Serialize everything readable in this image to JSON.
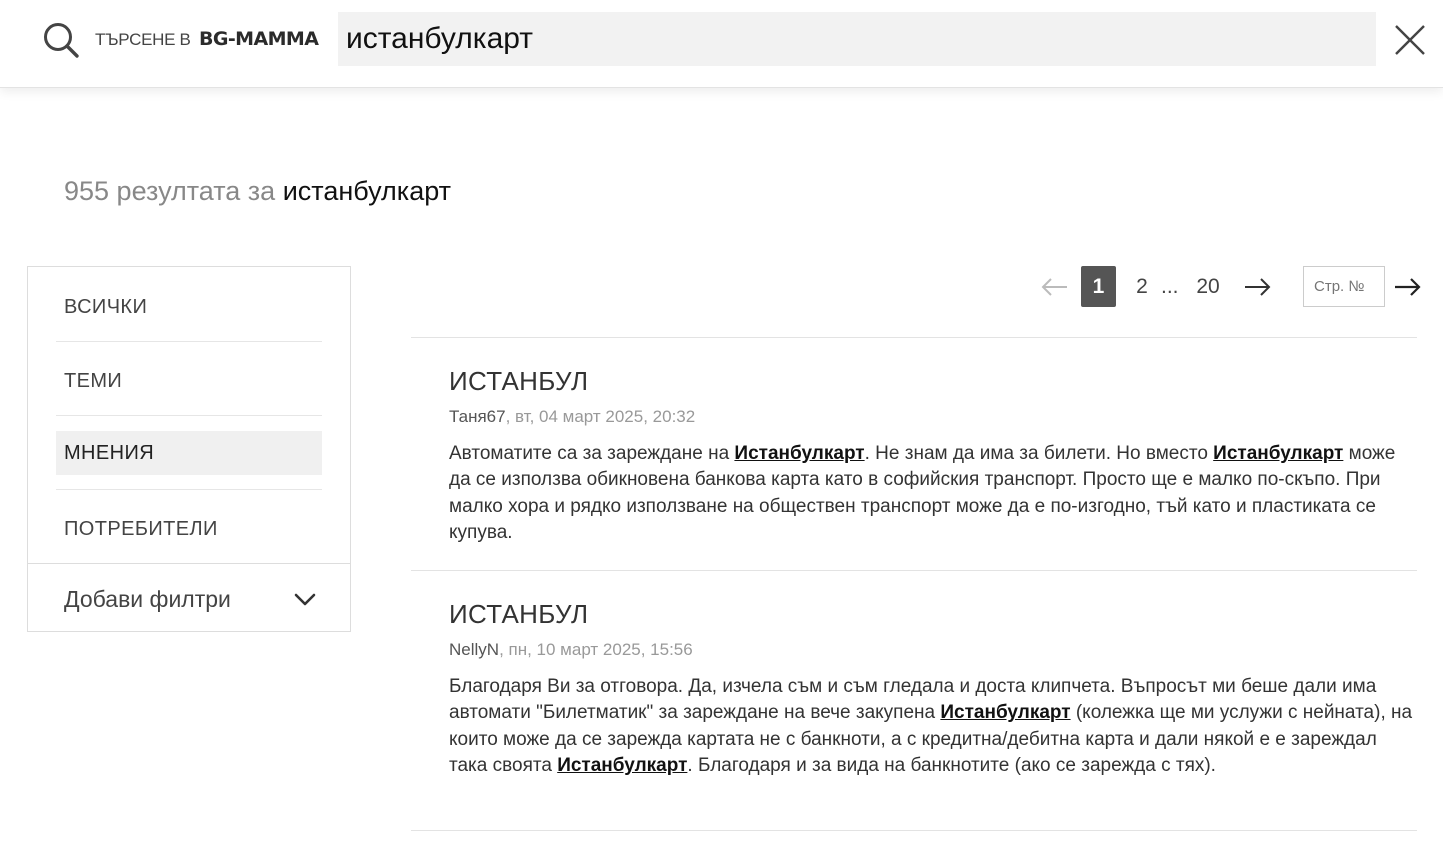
{
  "search": {
    "prefix": "ТЪРСЕНЕ В",
    "logo": "BG-MAMMA",
    "query": "истанбулкарт"
  },
  "summary": {
    "count_text": "955 резултата за ",
    "query": "истанбулкарт"
  },
  "sidebar": {
    "items": [
      {
        "label": "ВСИЧКИ",
        "active": false
      },
      {
        "label": "ТЕМИ",
        "active": false
      },
      {
        "label": "МНЕНИЯ",
        "active": true
      },
      {
        "label": "ПОТРЕБИТЕЛИ",
        "active": false
      }
    ],
    "filters_label": "Добави филтри"
  },
  "pagination": {
    "pages": [
      "1",
      "2",
      "20"
    ],
    "current": "1",
    "ellipsis": "...",
    "page_input_placeholder": "Стр. №"
  },
  "results": [
    {
      "title": "ИСТАНБУЛ",
      "author": "Таня67",
      "date": ", вт, 04 март 2025, 20:32",
      "text": [
        {
          "t": "Автоматите са за зареждане на "
        },
        {
          "t": "Истанбулкарт",
          "hl": true
        },
        {
          "t": ". Не знам да има за билети. Но вместо "
        },
        {
          "t": "Истанбулкарт",
          "hl": true
        },
        {
          "t": " може да се използва обикновена банкова карта като в софийския транспорт. Просто ще е малко по-скъпо. При малко хора и рядко използване на обществен транспорт може да е по-изгодно, тъй като и пластиката се купува."
        }
      ]
    },
    {
      "title": "ИСТАНБУЛ",
      "author": "NellyN",
      "date": ", пн, 10 март 2025, 15:56",
      "text": [
        {
          "t": "Благодаря Ви за отговора. Да, изчела съм и съм гледала и доста клипчета. Въпросът ми беше дали има автомати \"Билетматик\" за зареждане на вече закупена "
        },
        {
          "t": "Истанбулкарт",
          "hl": true
        },
        {
          "t": " (колежка ще ми услужи с нейната), на които може да се зарежда картата не с банкноти, а с кредитна/дебитна карта и дали някой е е зареждал така своята "
        },
        {
          "t": "Истанбулкарт",
          "hl": true
        },
        {
          "t": ". Благодаря и за вида на банкнотите (ако се зарежда с тях)."
        }
      ]
    }
  ]
}
